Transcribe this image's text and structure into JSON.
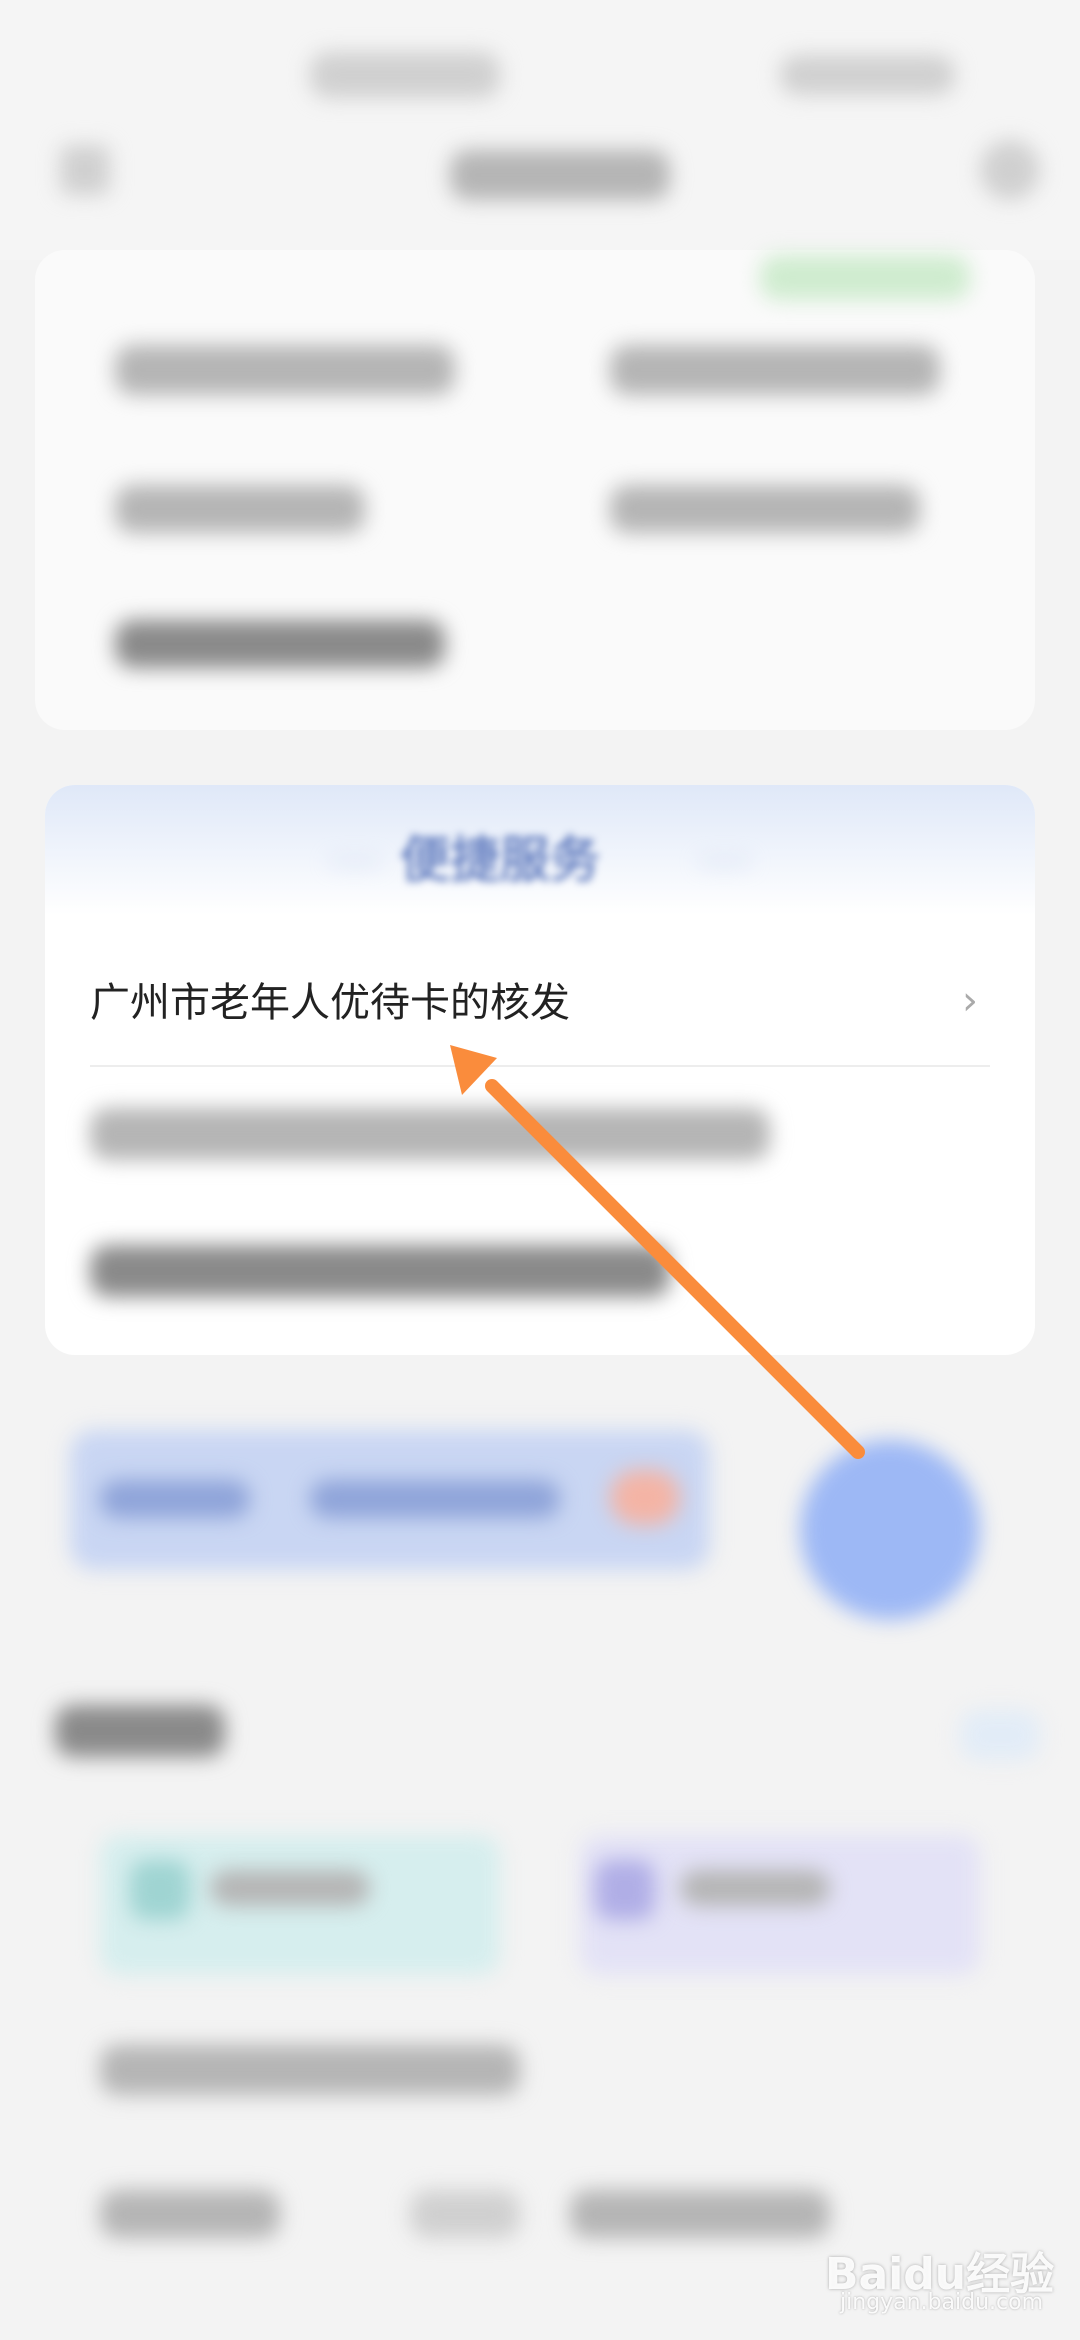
{
  "express_services": {
    "title": "便捷服务",
    "items": [
      {
        "label": "广州市老年人优待卡的核发"
      }
    ]
  },
  "annotation": {
    "color": "#fa8c3c"
  },
  "watermark": {
    "brand": "Baidu经验",
    "url": "jingyan.baidu.com"
  }
}
